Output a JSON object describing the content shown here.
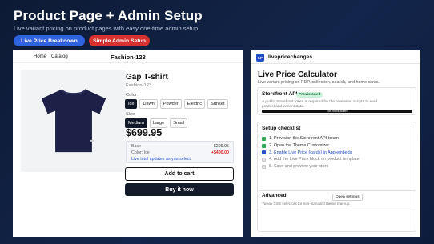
{
  "header": {
    "title": "Product Page + Admin Setup",
    "subtitle": "Live variant pricing on product pages with easy one-time admin setup",
    "buttons": [
      {
        "label": "Live Price Breakdown",
        "color": "#2f62de"
      },
      {
        "label": "Simple Admin Setup",
        "color": "#d8322e"
      }
    ]
  },
  "store": {
    "nav": [
      "Home",
      "Catalog"
    ],
    "name": "Fashion-123",
    "product": {
      "image_icon": "tshirt-icon",
      "title": "Gap T-shirt",
      "handle": "Fashion-123",
      "color_label": "Color",
      "colors": [
        "Ice",
        "Dawn",
        "Powder",
        "Electric",
        "Sunset"
      ],
      "selected_color": "Ice",
      "size_label": "Size",
      "sizes": [
        "Medium",
        "Large",
        "Small"
      ],
      "selected_size": "Medium",
      "price": "$699.95",
      "breakdown": {
        "base_label": "Base",
        "base_value": "$299.95",
        "color_label": "Color: Ice",
        "color_value": "+$400.00",
        "note": "Live total updates as you select"
      },
      "add_to_cart": "Add to cart",
      "buy_now": "Buy it now"
    }
  },
  "admin": {
    "logo": "LP",
    "app_name": "livepricechanges",
    "title": "Live Price Calculator",
    "subtitle": "Live variant pricing on PDP, collection, search, and home cards.",
    "api_card": {
      "heading": "Storefront API a",
      "badge": "Provisioned",
      "note": "A public Storefront token is required for the extension scripts to read product and variant data.",
      "action": "Re-check token"
    },
    "checklist": {
      "heading": "Setup checklist",
      "steps": [
        {
          "text": "1. Provision the Storefront API token",
          "state": "done"
        },
        {
          "text": "2. Open the Theme Customizer",
          "state": "done"
        },
        {
          "text": "3. Enable Live Price (cards) in App embeds",
          "state": "link"
        },
        {
          "text": "4. Add the Live Price block on product template",
          "state": "todo"
        },
        {
          "text": "5. Save and preview your store",
          "state": "todo"
        }
      ]
    },
    "advanced": {
      "heading": "Advanced",
      "button": "Open settings",
      "note": "Tweak CSS selectors for non-standard theme markup."
    }
  }
}
